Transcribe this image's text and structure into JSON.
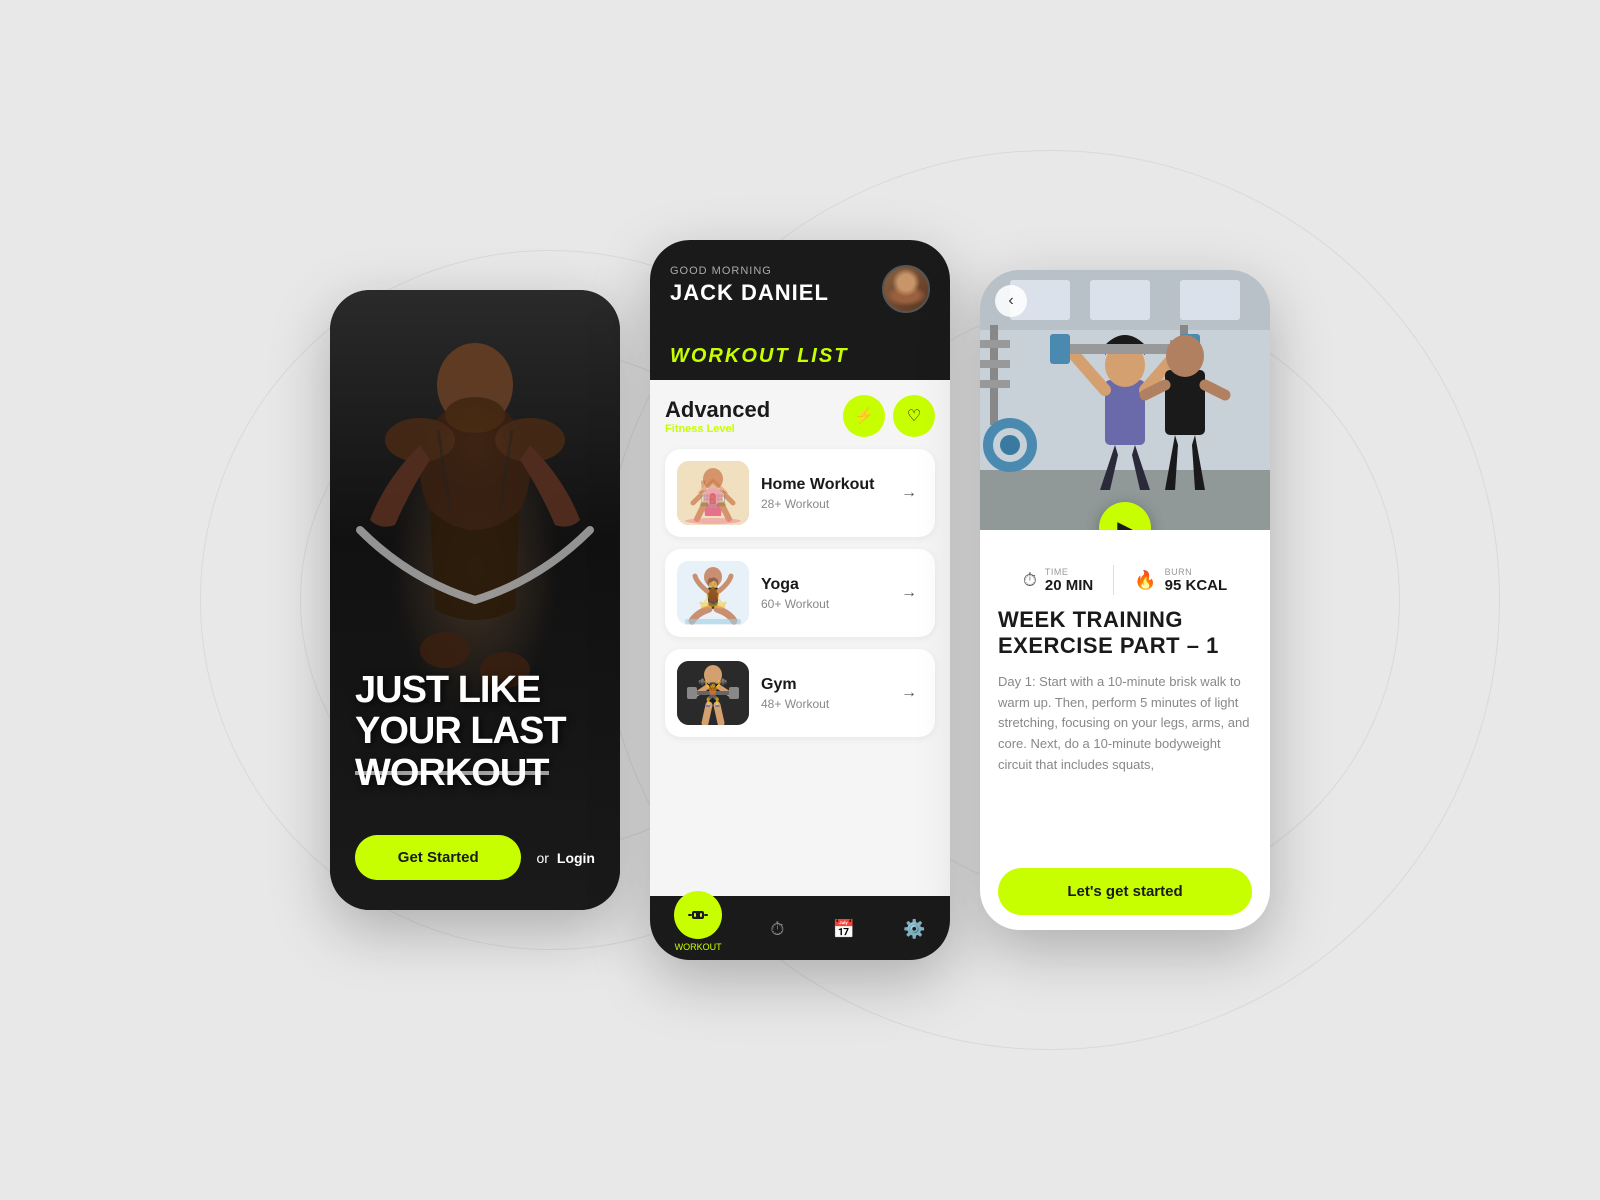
{
  "background": "#e8e8e8",
  "phone1": {
    "hero_title_line1": "JUST LIKE",
    "hero_title_line2": "YOUR LAST",
    "hero_title_line3": "WORKOUT",
    "get_started_label": "Get Started",
    "or_text": "or",
    "login_label": "Login"
  },
  "phone2": {
    "greeting": "GOOD MORNING",
    "user_name": "JACK DANIEL",
    "workout_list_label": "WORKOUT LIST",
    "fitness_title": "Advanced",
    "fitness_sub": "Fitness Level",
    "workouts": [
      {
        "name": "Home Workout",
        "count": "28+ Workout",
        "thumb": "home"
      },
      {
        "name": "Yoga",
        "count": "60+ Workout",
        "thumb": "yoga"
      },
      {
        "name": "Gym",
        "count": "48+ Workout",
        "thumb": "gym"
      }
    ],
    "nav_items": [
      {
        "label": "WORKOUT",
        "icon": "🏋️",
        "active": true
      },
      {
        "label": "",
        "icon": "⏱"
      },
      {
        "label": "",
        "icon": "📅"
      },
      {
        "label": "",
        "icon": "⚙"
      }
    ]
  },
  "phone3": {
    "time_label": "TIME",
    "time_value": "20 MIN",
    "burn_label": "BURN",
    "burn_value": "95 KCAL",
    "exercise_title_line1": "WEEK TRAINING",
    "exercise_title_line2": "EXERCISE PART – 1",
    "description": "Day 1: Start with a 10-minute brisk walk to warm up. Then, perform 5 minutes of light stretching, focusing on your legs, arms, and core. Next, do a 10-minute bodyweight circuit that includes squats,",
    "cta_label": "Let's get started"
  }
}
